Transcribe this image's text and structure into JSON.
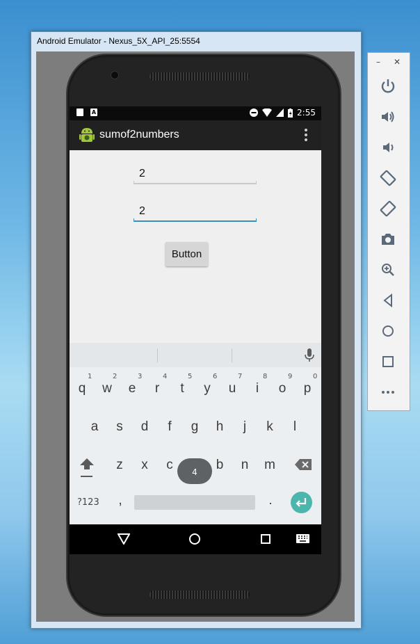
{
  "window": {
    "title": "Android Emulator - Nexus_5X_API_25:5554"
  },
  "statusbar": {
    "time": "2:55",
    "left_icons": [
      "sd-card-icon",
      "a-notification-icon"
    ],
    "right_icons": [
      "do-not-disturb-icon",
      "wifi-icon",
      "signal-icon",
      "battery-charging-icon"
    ]
  },
  "appbar": {
    "title": "sumof2numbers",
    "icon": "android-icon",
    "menu": "overflow-menu-icon"
  },
  "main": {
    "field1_value": "2",
    "field2_value": "2",
    "button_label": "Button"
  },
  "keyboard": {
    "row1": [
      "q",
      "w",
      "e",
      "r",
      "t",
      "y",
      "u",
      "i",
      "o",
      "p"
    ],
    "row1_numbers": [
      "1",
      "2",
      "3",
      "4",
      "5",
      "6",
      "7",
      "8",
      "9",
      "0"
    ],
    "row2": [
      "a",
      "s",
      "d",
      "f",
      "g",
      "h",
      "j",
      "k",
      "l"
    ],
    "row3": [
      "z",
      "x",
      "c",
      "v",
      "b",
      "n",
      "m"
    ],
    "symbols_label": "?123",
    "comma": ",",
    "period": ".",
    "popup_key": "4",
    "accent_color": "#4db6ac"
  },
  "navbar": {
    "icons": [
      "back-icon",
      "home-icon",
      "recents-icon",
      "keyboard-switch-icon"
    ]
  },
  "emulator_panel": {
    "minimize": "–",
    "close": "✕",
    "tools": [
      "power-icon",
      "volume-up-icon",
      "volume-down-icon",
      "rotate-left-icon",
      "rotate-right-icon",
      "camera-icon",
      "zoom-icon",
      "back-icon",
      "home-icon",
      "overview-icon",
      "more-icon"
    ]
  }
}
